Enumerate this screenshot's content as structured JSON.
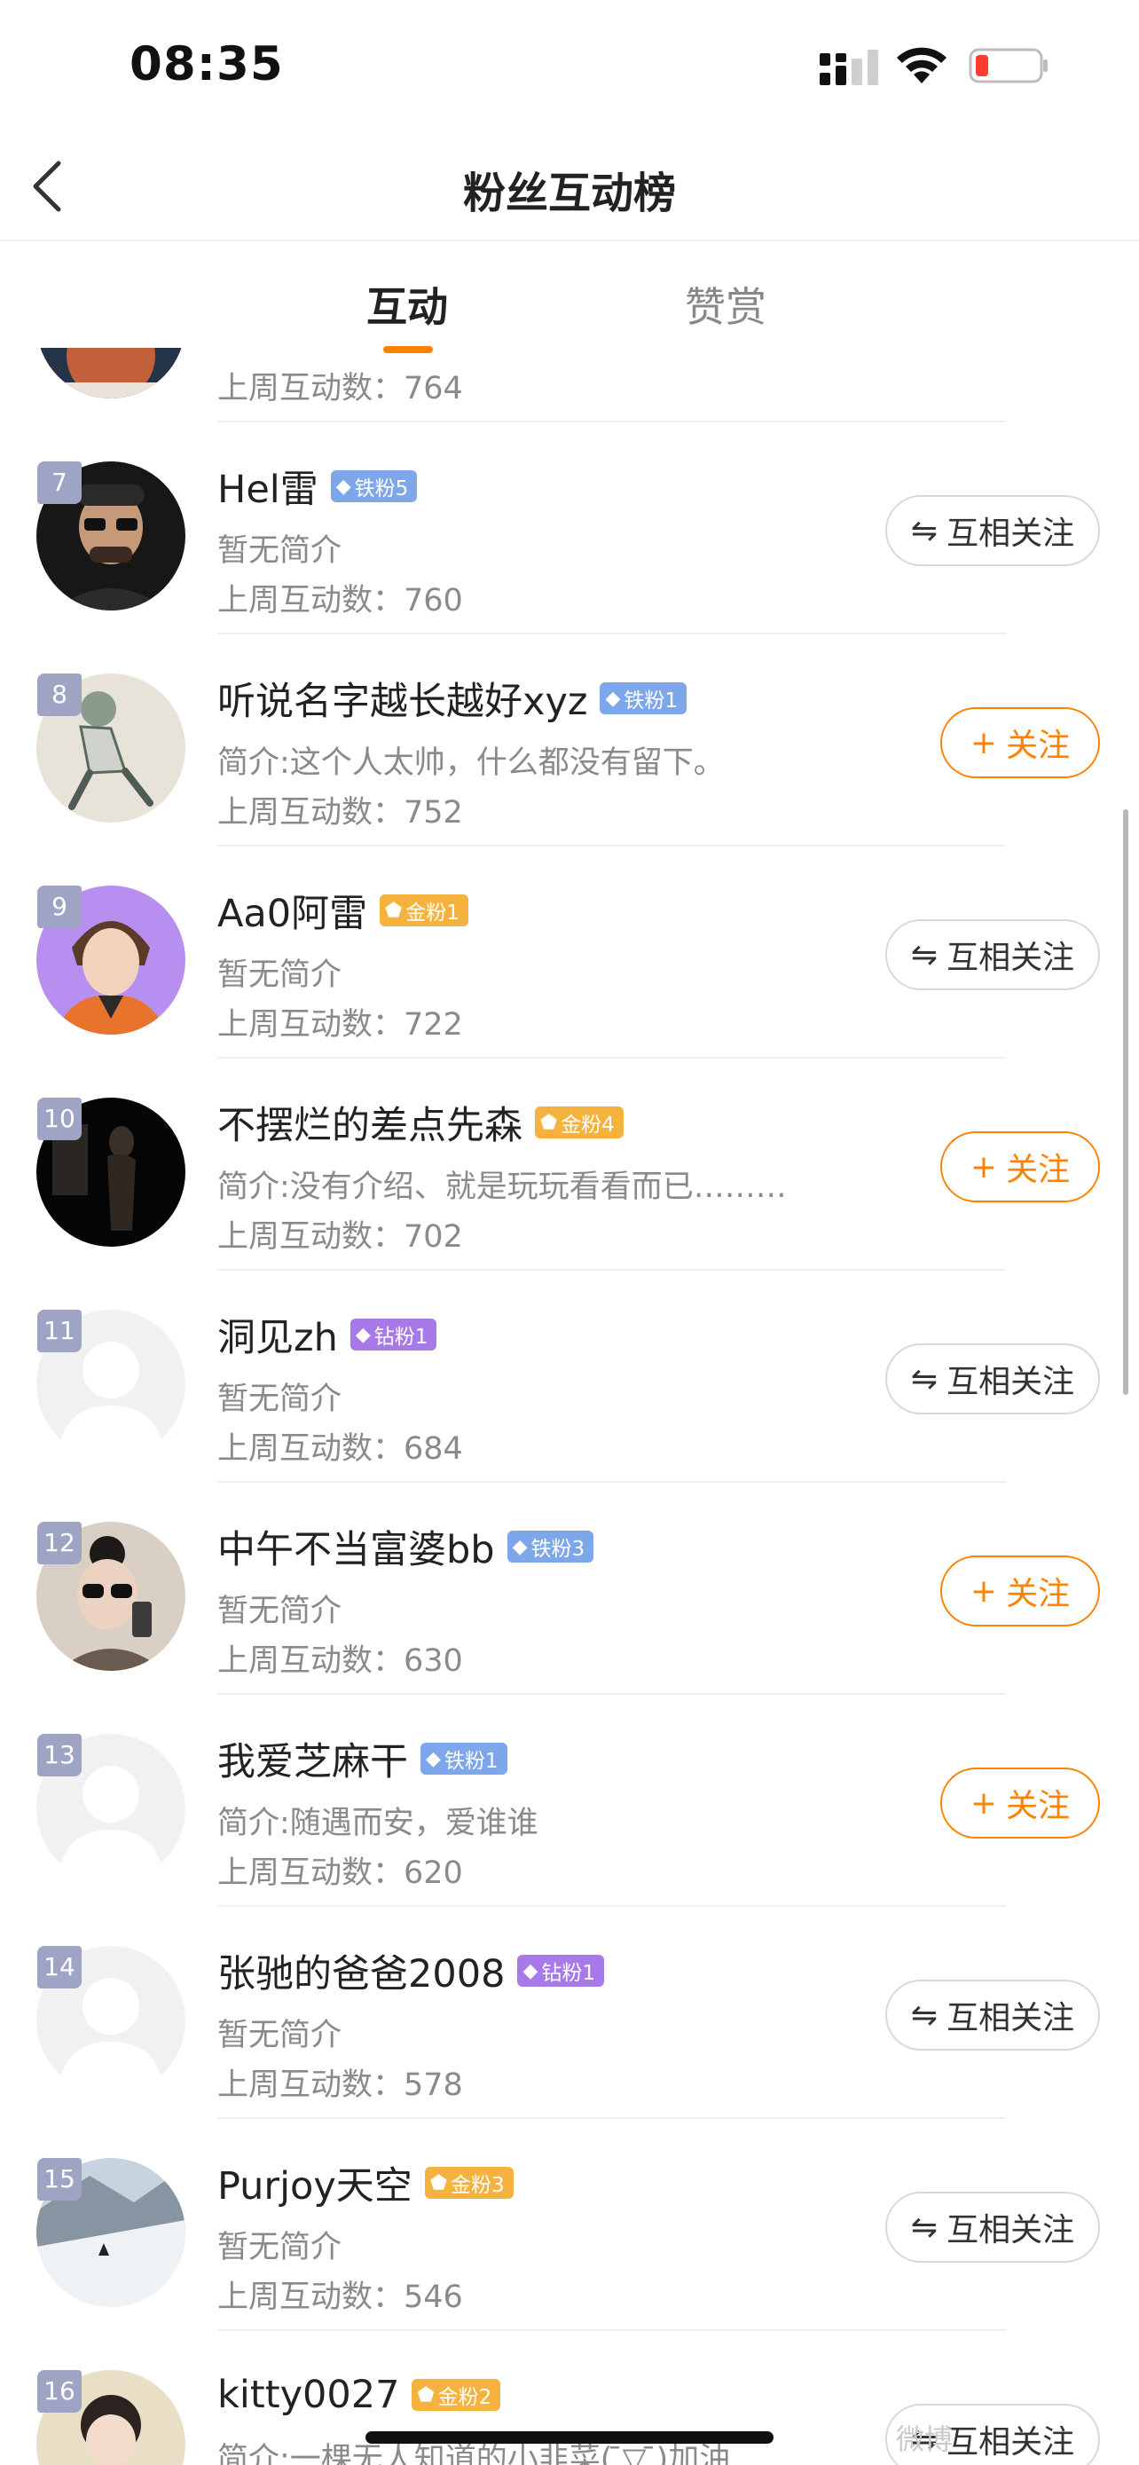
{
  "status_bar": {
    "time": "08:35"
  },
  "nav": {
    "title": "粉丝互动榜"
  },
  "tabs": [
    {
      "label": "互动",
      "active": true
    },
    {
      "label": "赞赏",
      "active": false
    }
  ],
  "buttons": {
    "mutual_icon": "⇋",
    "mutual": "互相关注",
    "follow_icon": "+",
    "follow": "关注"
  },
  "partial_row": {
    "count": "上周互动数：764"
  },
  "rows": [
    {
      "rank": "7",
      "name": "Hel雷",
      "badge": "铁粉5",
      "bio": "暂无简介",
      "count": "上周互动数：760",
      "button": "mutual"
    },
    {
      "rank": "8",
      "name": "听说名字越长越好xyz",
      "badge": "铁粉1",
      "bio": "简介:这个人太帅，什么都没有留下。",
      "count": "上周互动数：752",
      "button": "follow"
    },
    {
      "rank": "9",
      "name": "Aa0阿雷",
      "badge": "金粉1",
      "bio": "暂无简介",
      "count": "上周互动数：722",
      "button": "mutual"
    },
    {
      "rank": "10",
      "name": "不摆烂的差点先森",
      "badge": "金粉4",
      "bio": "简介:没有介绍、就是玩玩看看而已………",
      "count": "上周互动数：702",
      "button": "follow"
    },
    {
      "rank": "11",
      "name": "洞见zh",
      "badge": "钻粉1",
      "bio": "暂无简介",
      "count": "上周互动数：684",
      "button": "mutual"
    },
    {
      "rank": "12",
      "name": "中午不当富婆bb",
      "badge": "铁粉3",
      "bio": "暂无简介",
      "count": "上周互动数：630",
      "button": "follow"
    },
    {
      "rank": "13",
      "name": "我爱芝麻干",
      "badge": "铁粉1",
      "bio": "简介:随遇而安，爱谁谁",
      "count": "上周互动数：620",
      "button": "follow"
    },
    {
      "rank": "14",
      "name": "张驰的爸爸2008",
      "badge": "钻粉1",
      "bio": "暂无简介",
      "count": "上周互动数：578",
      "button": "mutual"
    },
    {
      "rank": "15",
      "name": "Purjoy天空",
      "badge": "金粉3",
      "bio": "暂无简介",
      "count": "上周互动数：546",
      "button": "mutual"
    },
    {
      "rank": "16",
      "name": "kitty0027",
      "badge": "金粉2",
      "bio": "简介:一棵无人知道的小韭菜( ̄▽ ̄)加油",
      "count": "",
      "button": "mutual"
    }
  ],
  "watermark": "微博",
  "colors": {
    "accent": "#ff8200",
    "iron": "#7ea6ea",
    "gold": "#f5b23e",
    "diamond": "#a779e9",
    "rank_bg": "#9fa4c4"
  }
}
